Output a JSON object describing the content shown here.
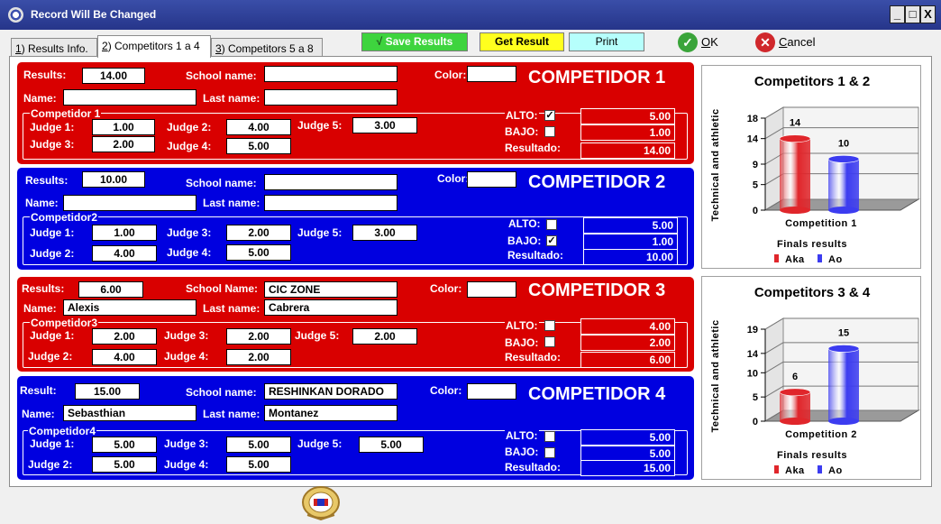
{
  "window": {
    "title": "Record Will Be Changed",
    "minimize": "_",
    "maximize": "□",
    "close": "X"
  },
  "tabs": [
    {
      "key": "1",
      "label": ") Results Info."
    },
    {
      "key": "2",
      "label": ") Competitors 1 a 4"
    },
    {
      "key": "3",
      "label": ") Competitors 5 a 8"
    }
  ],
  "toolbar": {
    "save": "Save Results",
    "get": "Get Result",
    "print": "Print",
    "ok_key": "O",
    "ok_rest": "K",
    "cancel_key": "C",
    "cancel_rest": "ancel"
  },
  "competitors": [
    {
      "heading": "COMPETIDOR 1",
      "results_label": "Results:",
      "results": "14.00",
      "school_label": "School name:",
      "school": "",
      "color_label": "Color:",
      "color": "",
      "name_label": "Name:",
      "name": "",
      "last_label": "Last name:",
      "last": "",
      "group": "Competidor 1",
      "judges": [
        {
          "label": "Judge 1:",
          "value": "1.00"
        },
        {
          "label": "Judge 2:",
          "value": "4.00"
        },
        {
          "label": "Judge 5:",
          "value": "3.00"
        },
        {
          "label": "Judge 3:",
          "value": "2.00"
        },
        {
          "label": "Judge 4:",
          "value": "5.00"
        }
      ],
      "alto_label": "ALTO:",
      "alto_checked": "✓",
      "alto": "5.00",
      "bajo_label": "BAJO:",
      "bajo_checked": "",
      "bajo": "1.00",
      "resultado_label": "Resultado:",
      "resultado": "14.00"
    },
    {
      "heading": "COMPETIDOR 2",
      "results_label": "Results:",
      "results": "10.00",
      "school_label": "School name:",
      "school": "",
      "color_label": "Color:",
      "color": "",
      "name_label": "Name:",
      "name": "",
      "last_label": "Last name:",
      "last": "",
      "group": "Competidor2",
      "judges": [
        {
          "label": "Judge 1:",
          "value": "1.00"
        },
        {
          "label": "Judge 3:",
          "value": "2.00"
        },
        {
          "label": "Judge 5:",
          "value": "3.00"
        },
        {
          "label": "Judge 2:",
          "value": "4.00"
        },
        {
          "label": "Judge 4:",
          "value": "5.00"
        }
      ],
      "alto_label": "ALTO:",
      "alto_checked": "",
      "alto": "5.00",
      "bajo_label": "BAJO:",
      "bajo_checked": "✓",
      "bajo": "1.00",
      "resultado_label": "Resultado:",
      "resultado": "10.00"
    },
    {
      "heading": "COMPETIDOR 3",
      "results_label": "Results:",
      "results": "6.00",
      "school_label": "School Name:",
      "school": "CIC ZONE",
      "color_label": "Color:",
      "color": "",
      "name_label": "Name:",
      "name": "Alexis",
      "last_label": "Last name:",
      "last": "Cabrera",
      "group": "Competidor3",
      "judges": [
        {
          "label": "Judge 1:",
          "value": "2.00"
        },
        {
          "label": "Judge 3:",
          "value": "2.00"
        },
        {
          "label": "Judge 5:",
          "value": "2.00"
        },
        {
          "label": "Judge 2:",
          "value": "4.00"
        },
        {
          "label": "Judge 4:",
          "value": "2.00"
        }
      ],
      "alto_label": "ALTO:",
      "alto_checked": "",
      "alto": "4.00",
      "bajo_label": "BAJO:",
      "bajo_checked": "",
      "bajo": "2.00",
      "resultado_label": "Resultado:",
      "resultado": "6.00"
    },
    {
      "heading": "COMPETIDOR 4",
      "results_label": "Result:",
      "results": "15.00",
      "school_label": "School name:",
      "school": "RESHINKAN DORADO",
      "color_label": "Color:",
      "color": "",
      "name_label": "Name:",
      "name": "Sebasthian",
      "last_label": "Last name:",
      "last": "Montanez",
      "group": "Competidor4",
      "judges": [
        {
          "label": "Judge 1:",
          "value": "5.00"
        },
        {
          "label": "Judge 3:",
          "value": "5.00"
        },
        {
          "label": "Judge 5:",
          "value": "5.00"
        },
        {
          "label": "Judge 2:",
          "value": "5.00"
        },
        {
          "label": "Judge 4:",
          "value": "5.00"
        }
      ],
      "alto_label": "ALTO:",
      "alto_checked": "",
      "alto": "5.00",
      "bajo_label": "BAJO:",
      "bajo_checked": "",
      "bajo": "5.00",
      "resultado_label": "Resultado:",
      "resultado": "15.00"
    }
  ],
  "chart_data": [
    {
      "type": "bar",
      "title": "Competitors 1 & 2",
      "categories": [
        "Competition 1"
      ],
      "ylabel": "Technical and athletic",
      "xlabel": "Finals results",
      "ylim": [
        0,
        18
      ],
      "yticks": [
        0,
        5,
        9,
        14,
        18
      ],
      "series": [
        {
          "name": "Aka",
          "values": [
            14
          ],
          "color": "#e0262b"
        },
        {
          "name": "Ao",
          "values": [
            10
          ],
          "color": "#3c3cf0"
        }
      ]
    },
    {
      "type": "bar",
      "title": "Competitors 3 & 4",
      "categories": [
        "Competition 2"
      ],
      "ylabel": "Technical and athletic",
      "xlabel": "Finals results",
      "ylim": [
        0,
        19
      ],
      "yticks": [
        0,
        5,
        10,
        14,
        19
      ],
      "series": [
        {
          "name": "Aka",
          "values": [
            6
          ],
          "color": "#e0262b"
        },
        {
          "name": "Ao",
          "values": [
            15
          ],
          "color": "#3c3cf0"
        }
      ]
    }
  ]
}
